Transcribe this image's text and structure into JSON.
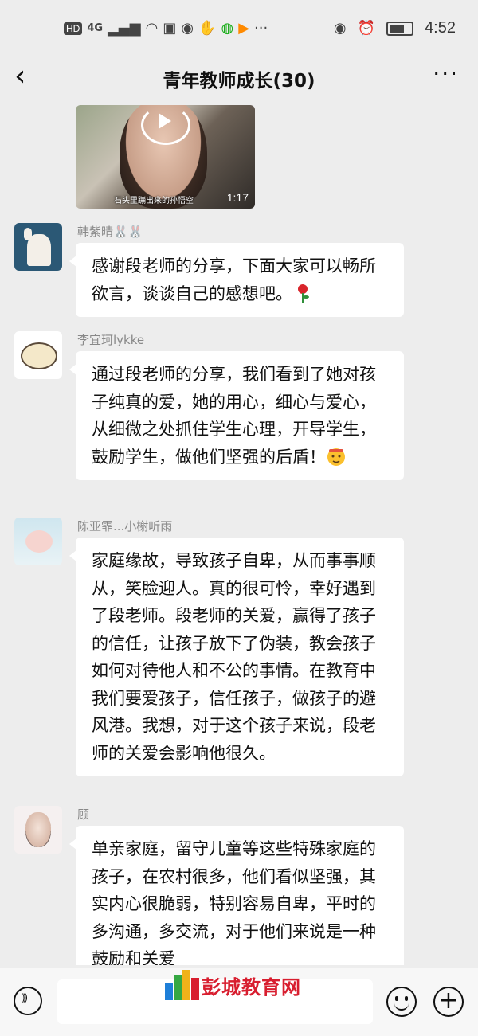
{
  "status_bar": {
    "network_badge": "HD",
    "signal": "4G",
    "time": "4:52"
  },
  "nav": {
    "back_icon": "chevron-left-icon",
    "title": "青年教师成长(30)",
    "more_icon": "more-icon"
  },
  "video": {
    "caption": "石头里蹦出来的孙悟空",
    "duration": "1:17"
  },
  "messages": [
    {
      "sender": "韩紫晴🐰🐰",
      "text": "感谢段老师的分享，下面大家可以畅所欲言，谈谈自己的感想吧。",
      "emoji": "rose-emoji"
    },
    {
      "sender": "李宜珂lykke",
      "text": "通过段老师的分享，我们看到了她对孩子纯真的爱，她的用心，细心与爱心，从细微之处抓住学生心理，开导学生，鼓励学生，做他们坚强的后盾！",
      "emoji": "salute-emoji"
    },
    {
      "sender": "陈亚霏...小榭听雨",
      "text": "家庭缘故，导致孩子自卑，从而事事顺从，笑脸迎人。真的很可怜，幸好遇到了段老师。段老师的关爱，赢得了孩子的信任，让孩子放下了伪装，教会孩子如何对待他人和不公的事情。在教育中我们要爱孩子，信任孩子，做孩子的避风港。我想，对于这个孩子来说，段老师的关爱会影响他很久。"
    },
    {
      "sender": "顾",
      "text": "单亲家庭，留守儿童等这些特殊家庭的孩子，在农村很多，他们看似坚强，其实内心很脆弱，特别容易自卑，平时的多沟通，多交流，对于他们来说是一种鼓励和关爱"
    }
  ],
  "input_bar": {
    "watermark": "彭城教育网",
    "voice_icon": "voice-icon",
    "emoji_icon": "smiley-icon",
    "plus_icon": "plus-icon"
  },
  "colors": {
    "background": "#ededed",
    "bubble": "#ffffff",
    "watermark": "#d81e2f"
  }
}
